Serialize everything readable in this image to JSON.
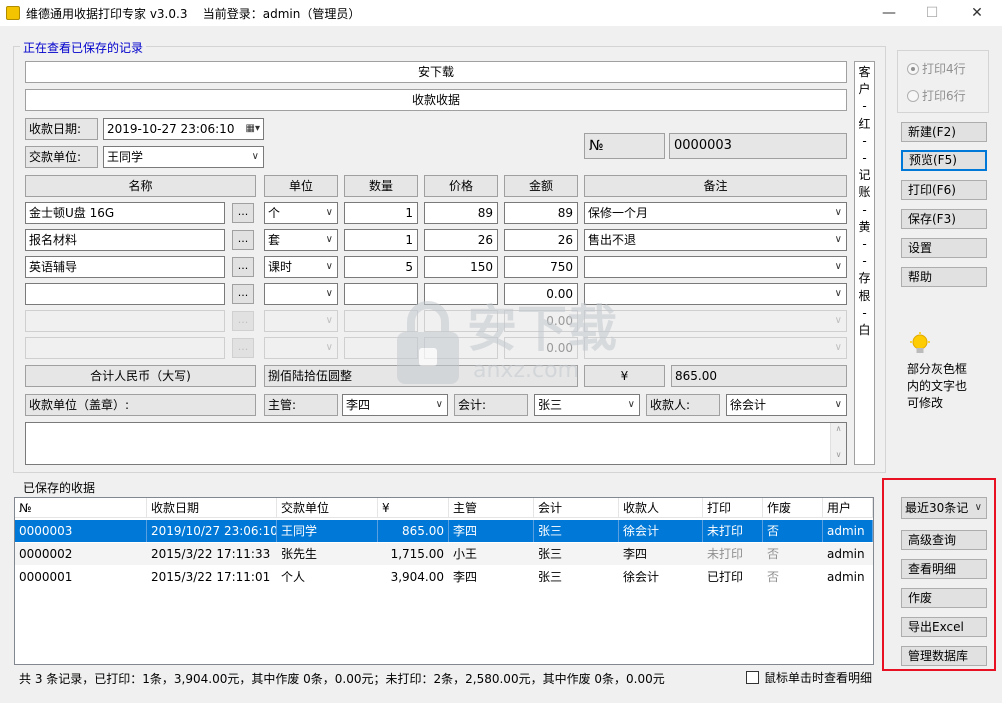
{
  "window": {
    "title": "维德通用收据打印专家 v3.0.3",
    "login": "当前登录：admin（管理员）",
    "min": "—",
    "max": "☐",
    "close": "✕"
  },
  "form": {
    "legend": "正在查看已保存的记录",
    "header_top": "安下载",
    "header_sub": "收款收据",
    "date_label": "收款日期:",
    "date_value": "2019-10-27 23:06:10",
    "payer_label": "交款单位:",
    "payer_value": "王同学",
    "no_label": "№",
    "no_value": "0000003",
    "columns": {
      "name": "名称",
      "unit": "单位",
      "qty": "数量",
      "price": "价格",
      "amount": "金额",
      "note": "备注"
    },
    "rows": [
      {
        "name": "金士顿U盘 16G",
        "unit": "个",
        "qty": "1",
        "price": "89",
        "amount": "89",
        "note": "保修一个月"
      },
      {
        "name": "报名材料",
        "unit": "套",
        "qty": "1",
        "price": "26",
        "amount": "26",
        "note": "售出不退"
      },
      {
        "name": "英语辅导",
        "unit": "课时",
        "qty": "5",
        "price": "150",
        "amount": "750",
        "note": ""
      },
      {
        "name": "",
        "unit": "",
        "qty": "",
        "price": "",
        "amount": "0.00",
        "note": ""
      },
      {
        "name": "",
        "unit": "",
        "qty": "",
        "price": "",
        "amount": "0.00",
        "note": ""
      },
      {
        "name": "",
        "unit": "",
        "qty": "",
        "price": "",
        "amount": "0.00",
        "note": ""
      }
    ],
    "dots": "...",
    "total_label": "合计人民币（大写)",
    "total_words": "捌佰陆拾伍圆整",
    "currency": "¥",
    "total_value": "865.00",
    "seal_label": "收款单位（盖章）:",
    "manager_label": "主管:",
    "manager_value": "李四",
    "accountant_label": "会计:",
    "accountant_value": "张三",
    "receiver_label": "收款人:",
    "receiver_value": "徐会计",
    "vertical_note": [
      "客",
      "户",
      "-",
      "红",
      "-",
      "-",
      "记",
      "账",
      "-",
      "黄",
      "-",
      "-",
      "存",
      "根",
      "-",
      "白"
    ]
  },
  "side": {
    "radio1": "打印4行",
    "radio2": "打印6行",
    "buttons": [
      "新建(F2)",
      "预览(F5)",
      "打印(F6)",
      "保存(F3)",
      "设置",
      "帮助"
    ],
    "hint": [
      "部分灰色框",
      "内的文字也",
      "可修改"
    ]
  },
  "saved": {
    "legend": "已保存的收据",
    "headers": [
      "№",
      "收款日期",
      "交款单位",
      "¥",
      "主管",
      "会计",
      "收款人",
      "打印",
      "作废",
      "用户"
    ],
    "rows": [
      [
        "0000003",
        "2019/10/27 23:06:10",
        "王同学",
        "865.00",
        "李四",
        "张三",
        "徐会计",
        "未打印",
        "否",
        "admin"
      ],
      [
        "0000002",
        "2015/3/22 17:11:33",
        "张先生",
        "1,715.00",
        "小王",
        "张三",
        "李四",
        "未打印",
        "否",
        "admin"
      ],
      [
        "0000001",
        "2015/3/22 17:11:01",
        "个人",
        "3,904.00",
        "李四",
        "张三",
        "徐会计",
        "已打印",
        "否",
        "admin"
      ]
    ],
    "filter": "最近30条记",
    "buttons": [
      "高级查询",
      "查看明细",
      "作废",
      "导出Excel",
      "管理数据库"
    ],
    "status": "共 3 条记录，已打印：1条，3,904.00元，其中作废  0条，0.00元；未打印：2条，2,580.00元，其中作废 0条，0.00元",
    "checkbox": "鼠标单击时查看明细"
  },
  "watermark": {
    "text": "安下载",
    "sub": "anxz.com"
  },
  "colors": {
    "selection": "#0078d7",
    "highlight_border": "#e81123",
    "legend_blue": "#0000cc"
  }
}
